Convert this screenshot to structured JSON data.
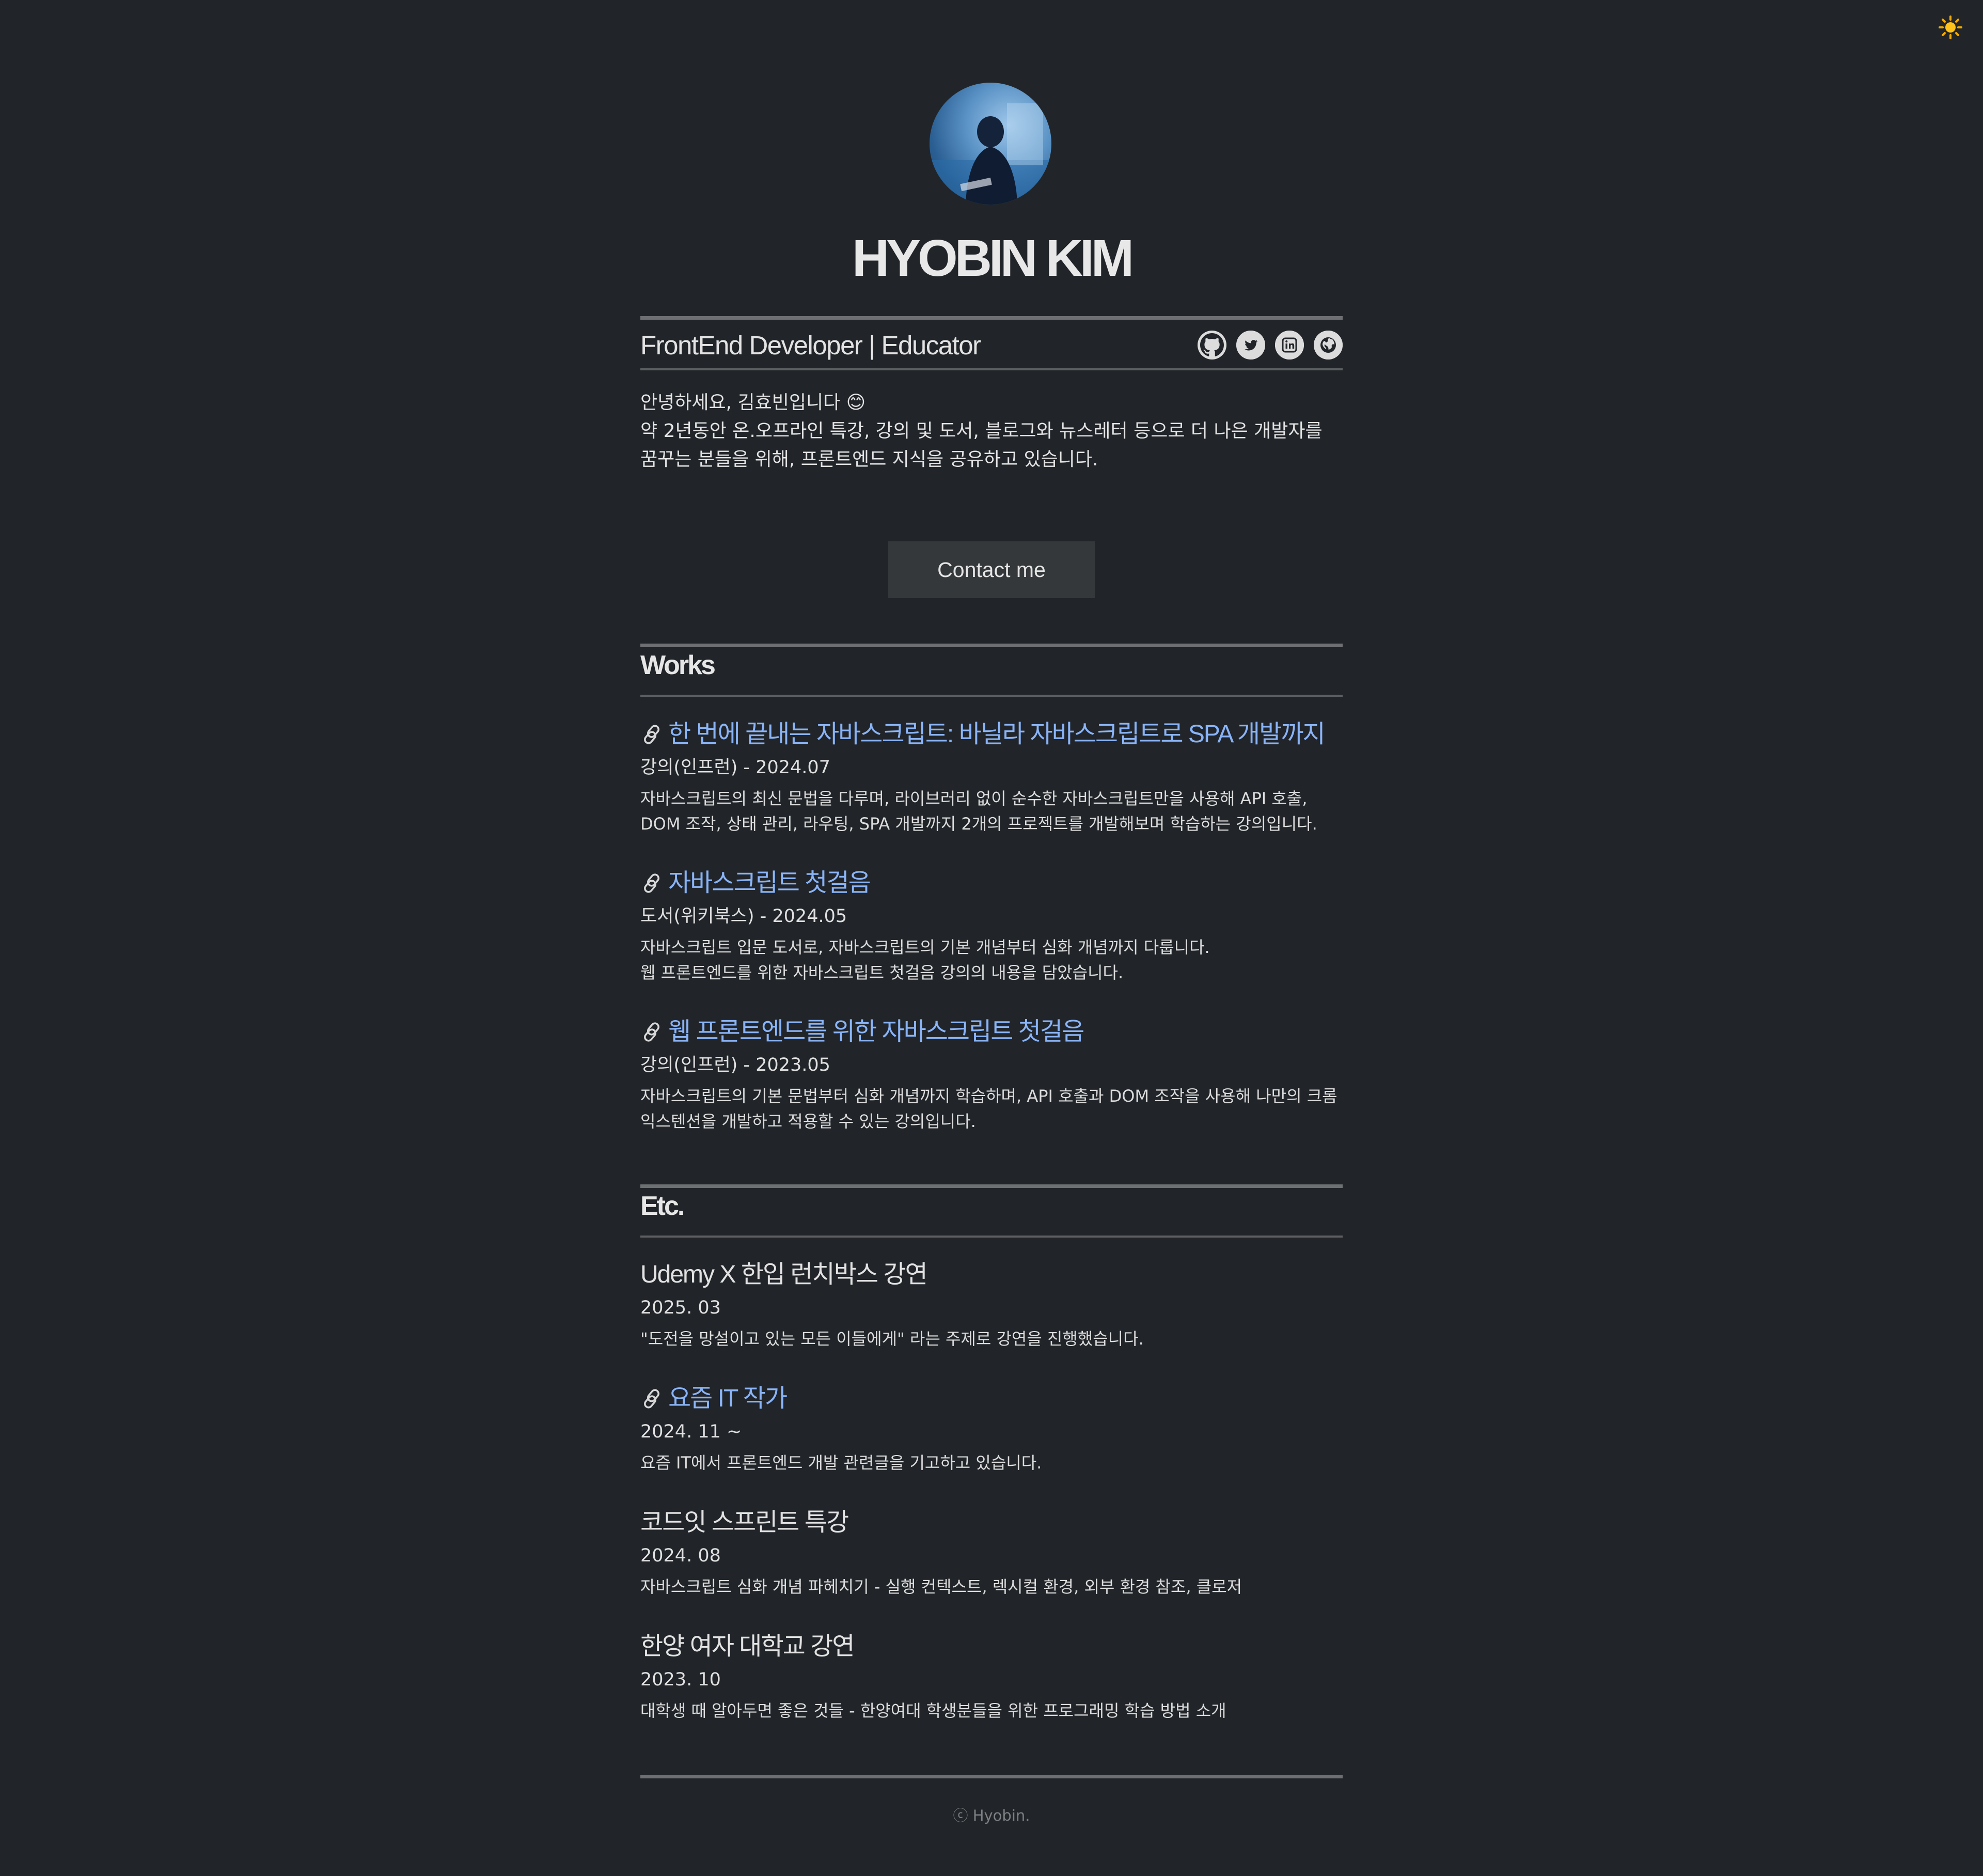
{
  "header": {
    "theme_toggle_icon": "sun-icon",
    "name": "HYOBIN KIM",
    "subtitle": "FrontEnd Developer | Educator",
    "socials": [
      {
        "icon": "github-icon"
      },
      {
        "icon": "twitter-icon"
      },
      {
        "icon": "linkedin-icon"
      },
      {
        "icon": "globe-icon"
      }
    ]
  },
  "intro": {
    "line1": "안녕하세요, 김효빈입니다 😊",
    "line2": "약 2년동안 온.오프라인 특강, 강의 및 도서, 블로그와 뉴스레터 등으로 더 나은 개발자를 꿈꾸는 분들을 위해, 프론트엔드 지식을 공유하고 있습니다."
  },
  "contact_label": "Contact me",
  "works": {
    "title": "Works",
    "items": [
      {
        "title": "한 번에 끝내는 자바스크립트: 바닐라 자바스크립트로 SPA 개발까지",
        "meta": "강의(인프런) - 2024.07",
        "desc1": "자바스크립트의 최신 문법을 다루며, 라이브러리 없이 순수한 자바스크립트만을 사용해 API 호출, DOM 조작, 상태 관리, 라우팅, SPA 개발까지 2개의 프로젝트를 개발해보며 학습하는 강의입니다.",
        "desc2": ""
      },
      {
        "title": "자바스크립트 첫걸음",
        "meta": "도서(위키북스) - 2024.05",
        "desc1": "자바스크립트 입문 도서로, 자바스크립트의 기본 개념부터 심화 개념까지 다룹니다.",
        "desc2": "웹 프론트엔드를 위한 자바스크립트 첫걸음 강의의 내용을 담았습니다."
      },
      {
        "title": "웹 프론트엔드를 위한 자바스크립트 첫걸음",
        "meta": "강의(인프런) - 2023.05",
        "desc1": "자바스크립트의 기본 문법부터 심화 개념까지 학습하며, API 호출과 DOM 조작을 사용해 나만의 크롬 익스텐션을 개발하고 적용할 수 있는 강의입니다.",
        "desc2": ""
      }
    ]
  },
  "etc": {
    "title": "Etc.",
    "items": [
      {
        "title": "Udemy X 한입 런치박스 강연",
        "meta": "2025. 03",
        "desc": "\"도전을 망설이고 있는 모든 이들에게\" 라는 주제로 강연을 진행했습니다."
      },
      {
        "title": "요즘 IT 작가",
        "meta": "2024. 11 ~",
        "desc": "요즘 IT에서 프론트엔드 개발 관련글을 기고하고 있습니다."
      },
      {
        "title": "코드잇 스프린트 특강",
        "meta": "2024. 08",
        "desc": "자바스크립트 심화 개념 파헤치기 - 실행 컨텍스트, 렉시컬 환경, 외부 환경 참조, 클로저"
      },
      {
        "title": "한양 여자 대학교 강연",
        "meta": "2023. 10",
        "desc": "대학생 때 알아두면 좋은 것들 - 한양여대 학생분들을 위한 프로그래밍 학습 방법 소개"
      }
    ]
  },
  "footer": "ⓒ Hyobin."
}
